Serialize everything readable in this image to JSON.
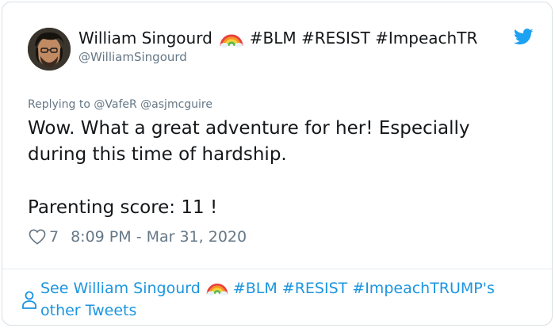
{
  "author": {
    "display_name": "William Singourd",
    "hashtags": "#BLM #RESIST #ImpeachTR",
    "handle": "@WilliamSingourd"
  },
  "reply": {
    "prefix": "Replying to",
    "mentions": "@VafeR @asjmcguire"
  },
  "tweet": {
    "paragraph1": "Wow. What a great adventure for her! Especially during this time of hardship.",
    "paragraph2": "Parenting score: 11 !"
  },
  "meta": {
    "like_count": "7",
    "timestamp": "8:09 PM - Mar 31, 2020"
  },
  "footer": {
    "prefix": "See William Singourd",
    "suffix": "#BLM #RESIST #ImpeachTRUMP's other Tweets"
  },
  "icons": {
    "avatar": "avatar",
    "rainbow": "rainbow-emoji-icon",
    "bird": "twitter-bird-icon",
    "heart": "heart-icon",
    "person": "person-icon"
  },
  "colors": {
    "text": "#14171a",
    "secondary": "#657786",
    "link": "#1b95e0",
    "border": "#d9dfe4"
  }
}
